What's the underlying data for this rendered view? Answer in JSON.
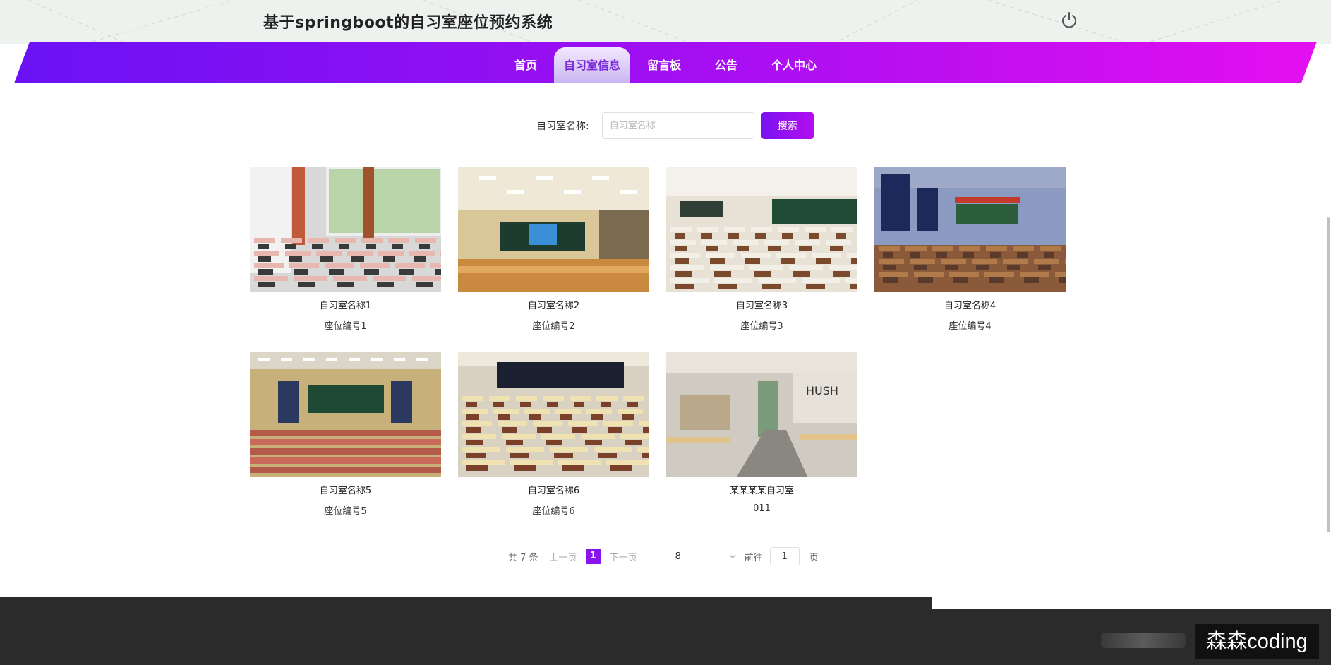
{
  "header": {
    "site_title": "基于springboot的自习室座位预约系统",
    "power_icon": "power-icon"
  },
  "nav": {
    "items": [
      {
        "label": "首页",
        "active": false
      },
      {
        "label": "自习室信息",
        "active": true
      },
      {
        "label": "留言板",
        "active": false
      },
      {
        "label": "公告",
        "active": false
      },
      {
        "label": "个人中心",
        "active": false
      }
    ]
  },
  "search": {
    "label": "自习室名称:",
    "placeholder": "自习室名称",
    "value": "",
    "button_label": "搜索"
  },
  "rooms": [
    {
      "name": "自习室名称1",
      "seat": "座位编号1",
      "scene": "classroom-window"
    },
    {
      "name": "自习室名称2",
      "seat": "座位编号2",
      "scene": "classroom-screen"
    },
    {
      "name": "自习室名称3",
      "seat": "座位编号3",
      "scene": "classroom-rows"
    },
    {
      "name": "自习室名称4",
      "seat": "座位编号4",
      "scene": "classroom-anime"
    },
    {
      "name": "自习室名称5",
      "seat": "座位编号5",
      "scene": "lecture-hall"
    },
    {
      "name": "自习室名称6",
      "seat": "座位编号6",
      "scene": "classroom-desks"
    },
    {
      "name": "某某某某自习室",
      "seat": "011",
      "scene": "cafe-study"
    }
  ],
  "pagination": {
    "total_text": "共 7 条",
    "prev_label": "上一页",
    "current_page": "1",
    "next_label": "下一页",
    "page_size": "8",
    "goto_label": "前往",
    "goto_value": "1",
    "page_unit": "页"
  },
  "watermark": "森森coding",
  "colors": {
    "nav_start": "#6a12f5",
    "nav_end": "#e40ff0",
    "accent": "#8a14f0",
    "footer": "#2b2b2b"
  }
}
